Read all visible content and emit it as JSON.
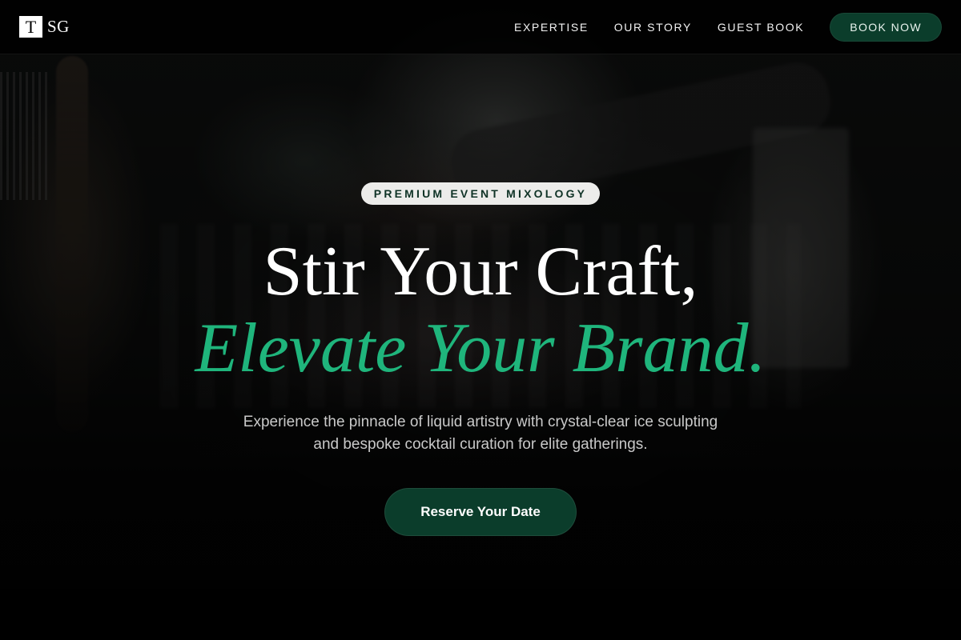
{
  "header": {
    "logo_mark": "T",
    "logo_text": "SG",
    "nav": [
      "EXPERTISE",
      "OUR STORY",
      "GUEST BOOK"
    ],
    "book_label": "BOOK NOW"
  },
  "hero": {
    "eyebrow": "PREMIUM EVENT MIXOLOGY",
    "headline_line1": "Stir Your Craft,",
    "headline_line2": "Elevate Your Brand.",
    "subtitle": "Experience the pinnacle of liquid artistry with crystal-clear ice sculpting and bespoke cocktail curation for elite gatherings.",
    "cta_label": "Reserve Your Date"
  },
  "colors": {
    "accent_green": "#1fb57c",
    "button_green": "#0b3d2b",
    "header_bg": "#000000"
  }
}
